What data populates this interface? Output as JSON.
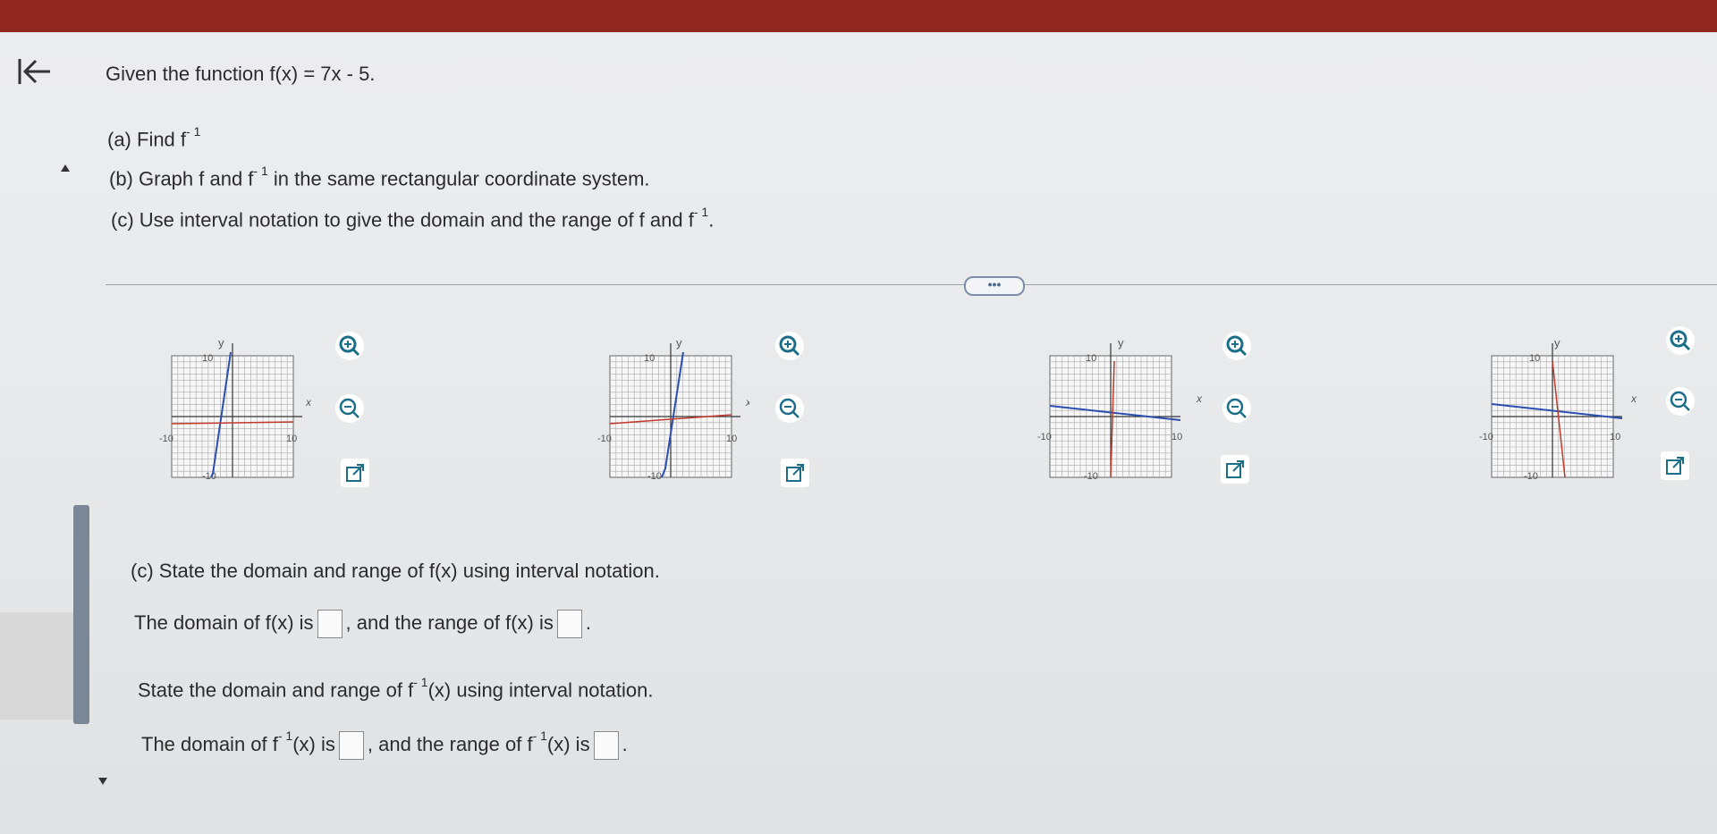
{
  "problem": {
    "intro": "Given the function f(x) = 7x - 5.",
    "part_a": "(a) Find f",
    "part_a_sup": "- 1",
    "part_b_pre": "(b) Graph f and f",
    "part_b_sup": "- 1",
    "part_b_post": "in the same rectangular coordinate system.",
    "part_c_pre": "(c) Use interval notation to give the domain and the range of f and f",
    "part_c_sup": "- 1",
    "part_c_post": "."
  },
  "more_button": "•••",
  "graph_labels": {
    "y": "y",
    "x": "x",
    "ymax": "10",
    "ymin": "-10",
    "xmin": "-10",
    "xmax": "10"
  },
  "question": {
    "heading": "(c) State the domain and range of f(x) using interval notation.",
    "line1_pre": "The domain of f(x) is",
    "line1_mid": ", and the range of f(x) is",
    "line1_post": ".",
    "prompt2_pre": "State the domain and range of f",
    "prompt2_sup": "- 1",
    "prompt2_post": "(x) using interval notation.",
    "line2_pre": "The domain of f",
    "line2_sup": "- 1",
    "line2_mid1": "(x) is",
    "line2_mid2": ", and the range of f",
    "line2_sup2": "- 1",
    "line2_mid3": "(x) is",
    "line2_post": "."
  },
  "answers": {
    "domain_f": "",
    "range_f": "",
    "domain_finv": "",
    "range_finv": ""
  },
  "colors": {
    "topbar": "#8f2620",
    "curve_blue": "#2a4fb0",
    "curve_red": "#c0392b",
    "tool_teal": "#1b6e8a"
  },
  "icons": [
    "back-arrow-icon",
    "zoom-in-icon",
    "zoom-out-icon",
    "open-external-icon"
  ]
}
